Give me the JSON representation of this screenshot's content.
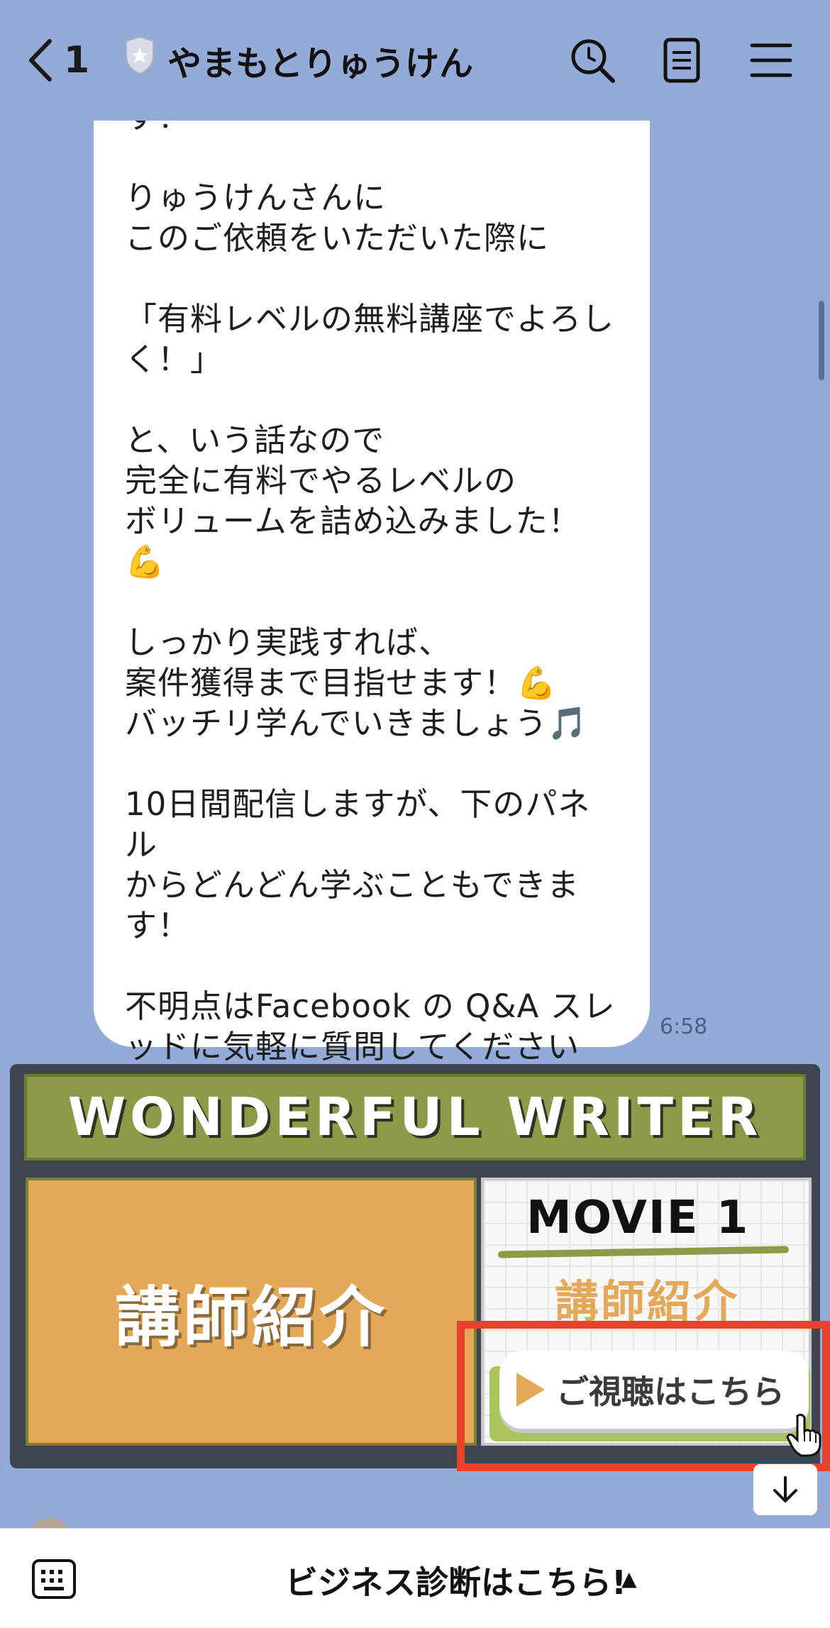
{
  "header": {
    "back_count": "1",
    "title": "やまもとりゅうけん",
    "icons": [
      "chevron-left-icon",
      "shield-icon",
      "search-icon",
      "notes-icon",
      "menu-icon"
    ]
  },
  "message": {
    "text": "す！\n\nりゅうけんさんに\nこのご依頼をいただいた際に\n\n「有料レベルの無料講座でよろし\nく！」\n\nと、いう話なので\n完全に有料でやるレベルの\nボリュームを詰め込みました！💪\n\nしっかり実践すれば、\n案件獲得まで目指せます！💪\nバッチリ学んでいきましょう🎵\n\n10日間配信しますが、下のパネル\nからどんどん学ぶこともできま\nす！\n\n不明点はFacebook の Q&A スレ\nッドに気軽に質問してください\nね！",
    "time": "6:58"
  },
  "card": {
    "banner": "WONDERFUL WRITER",
    "left_title": "講師紹介",
    "movie_label": "MOVIE 1",
    "right_title": "講師紹介",
    "cta_label": "ご視聴はこちら"
  },
  "bottom": {
    "menu_label": "ビジネス診断はこちら!",
    "arrow": "▲"
  },
  "colors": {
    "background": "#94aad7",
    "banner": "#8d9a48",
    "orange": "#e3a858",
    "highlight": "#e8432a"
  }
}
